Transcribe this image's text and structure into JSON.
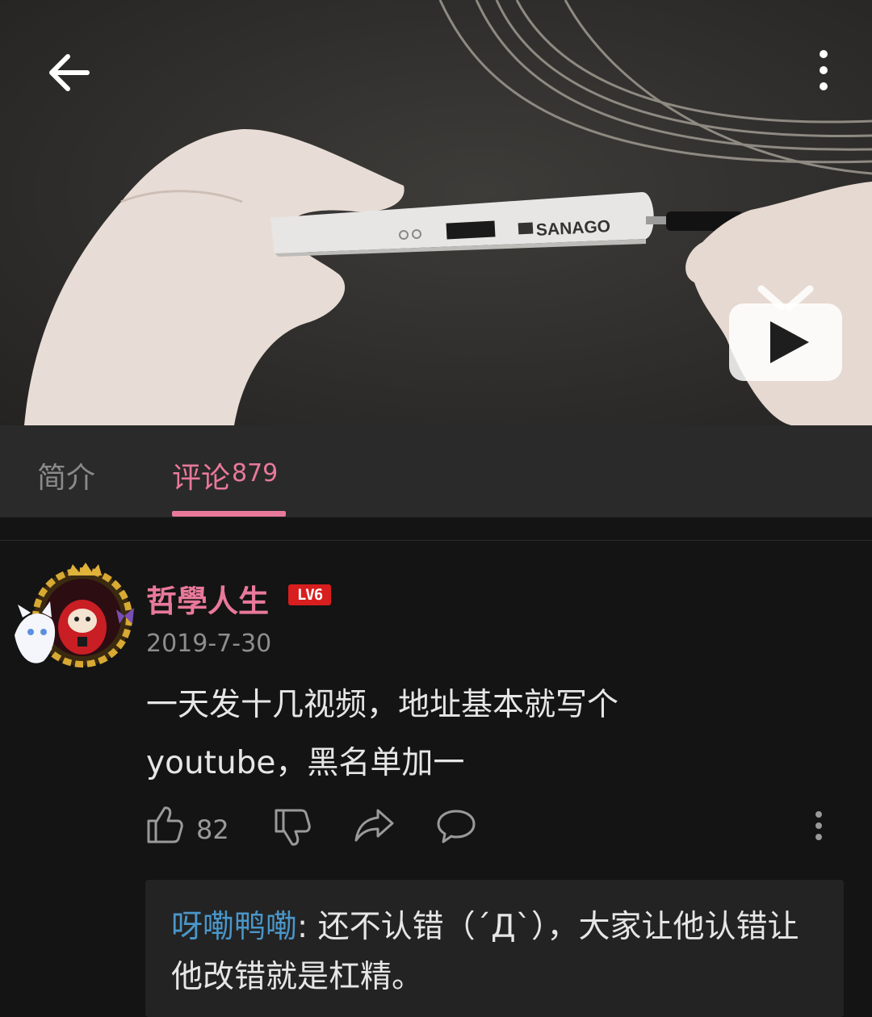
{
  "video": {
    "brand_text": "SANAGO",
    "icons": {
      "back": "arrow-left-icon",
      "more": "more-vertical-icon",
      "tv": "tv-play-icon"
    }
  },
  "tabs": {
    "intro_label": "简介",
    "comments_label": "评论",
    "comments_count": "879",
    "active": "comments"
  },
  "comment": {
    "username": "哲學人生",
    "level": "LV6",
    "date": "2019-7-30",
    "text_line1": "一天发十几视频，地址基本就写个",
    "text_line2": "youtube，黑名单加一",
    "likes": "82",
    "icons": [
      "thumb-up-icon",
      "thumb-down-icon",
      "share-icon",
      "reply-icon",
      "more-vertical-icon"
    ]
  },
  "reply_preview": {
    "username": "呀嘞鸭嘞",
    "separator": ": ",
    "text": "还不认错（´Д`），大家让他认错让他改错就是杠精。"
  },
  "colors": {
    "accent_pink": "#e8799a",
    "reply_user_blue": "#4a96c9",
    "level_red": "#d81e1e",
    "background": "#141414",
    "tabbar": "#2a2a2a"
  }
}
